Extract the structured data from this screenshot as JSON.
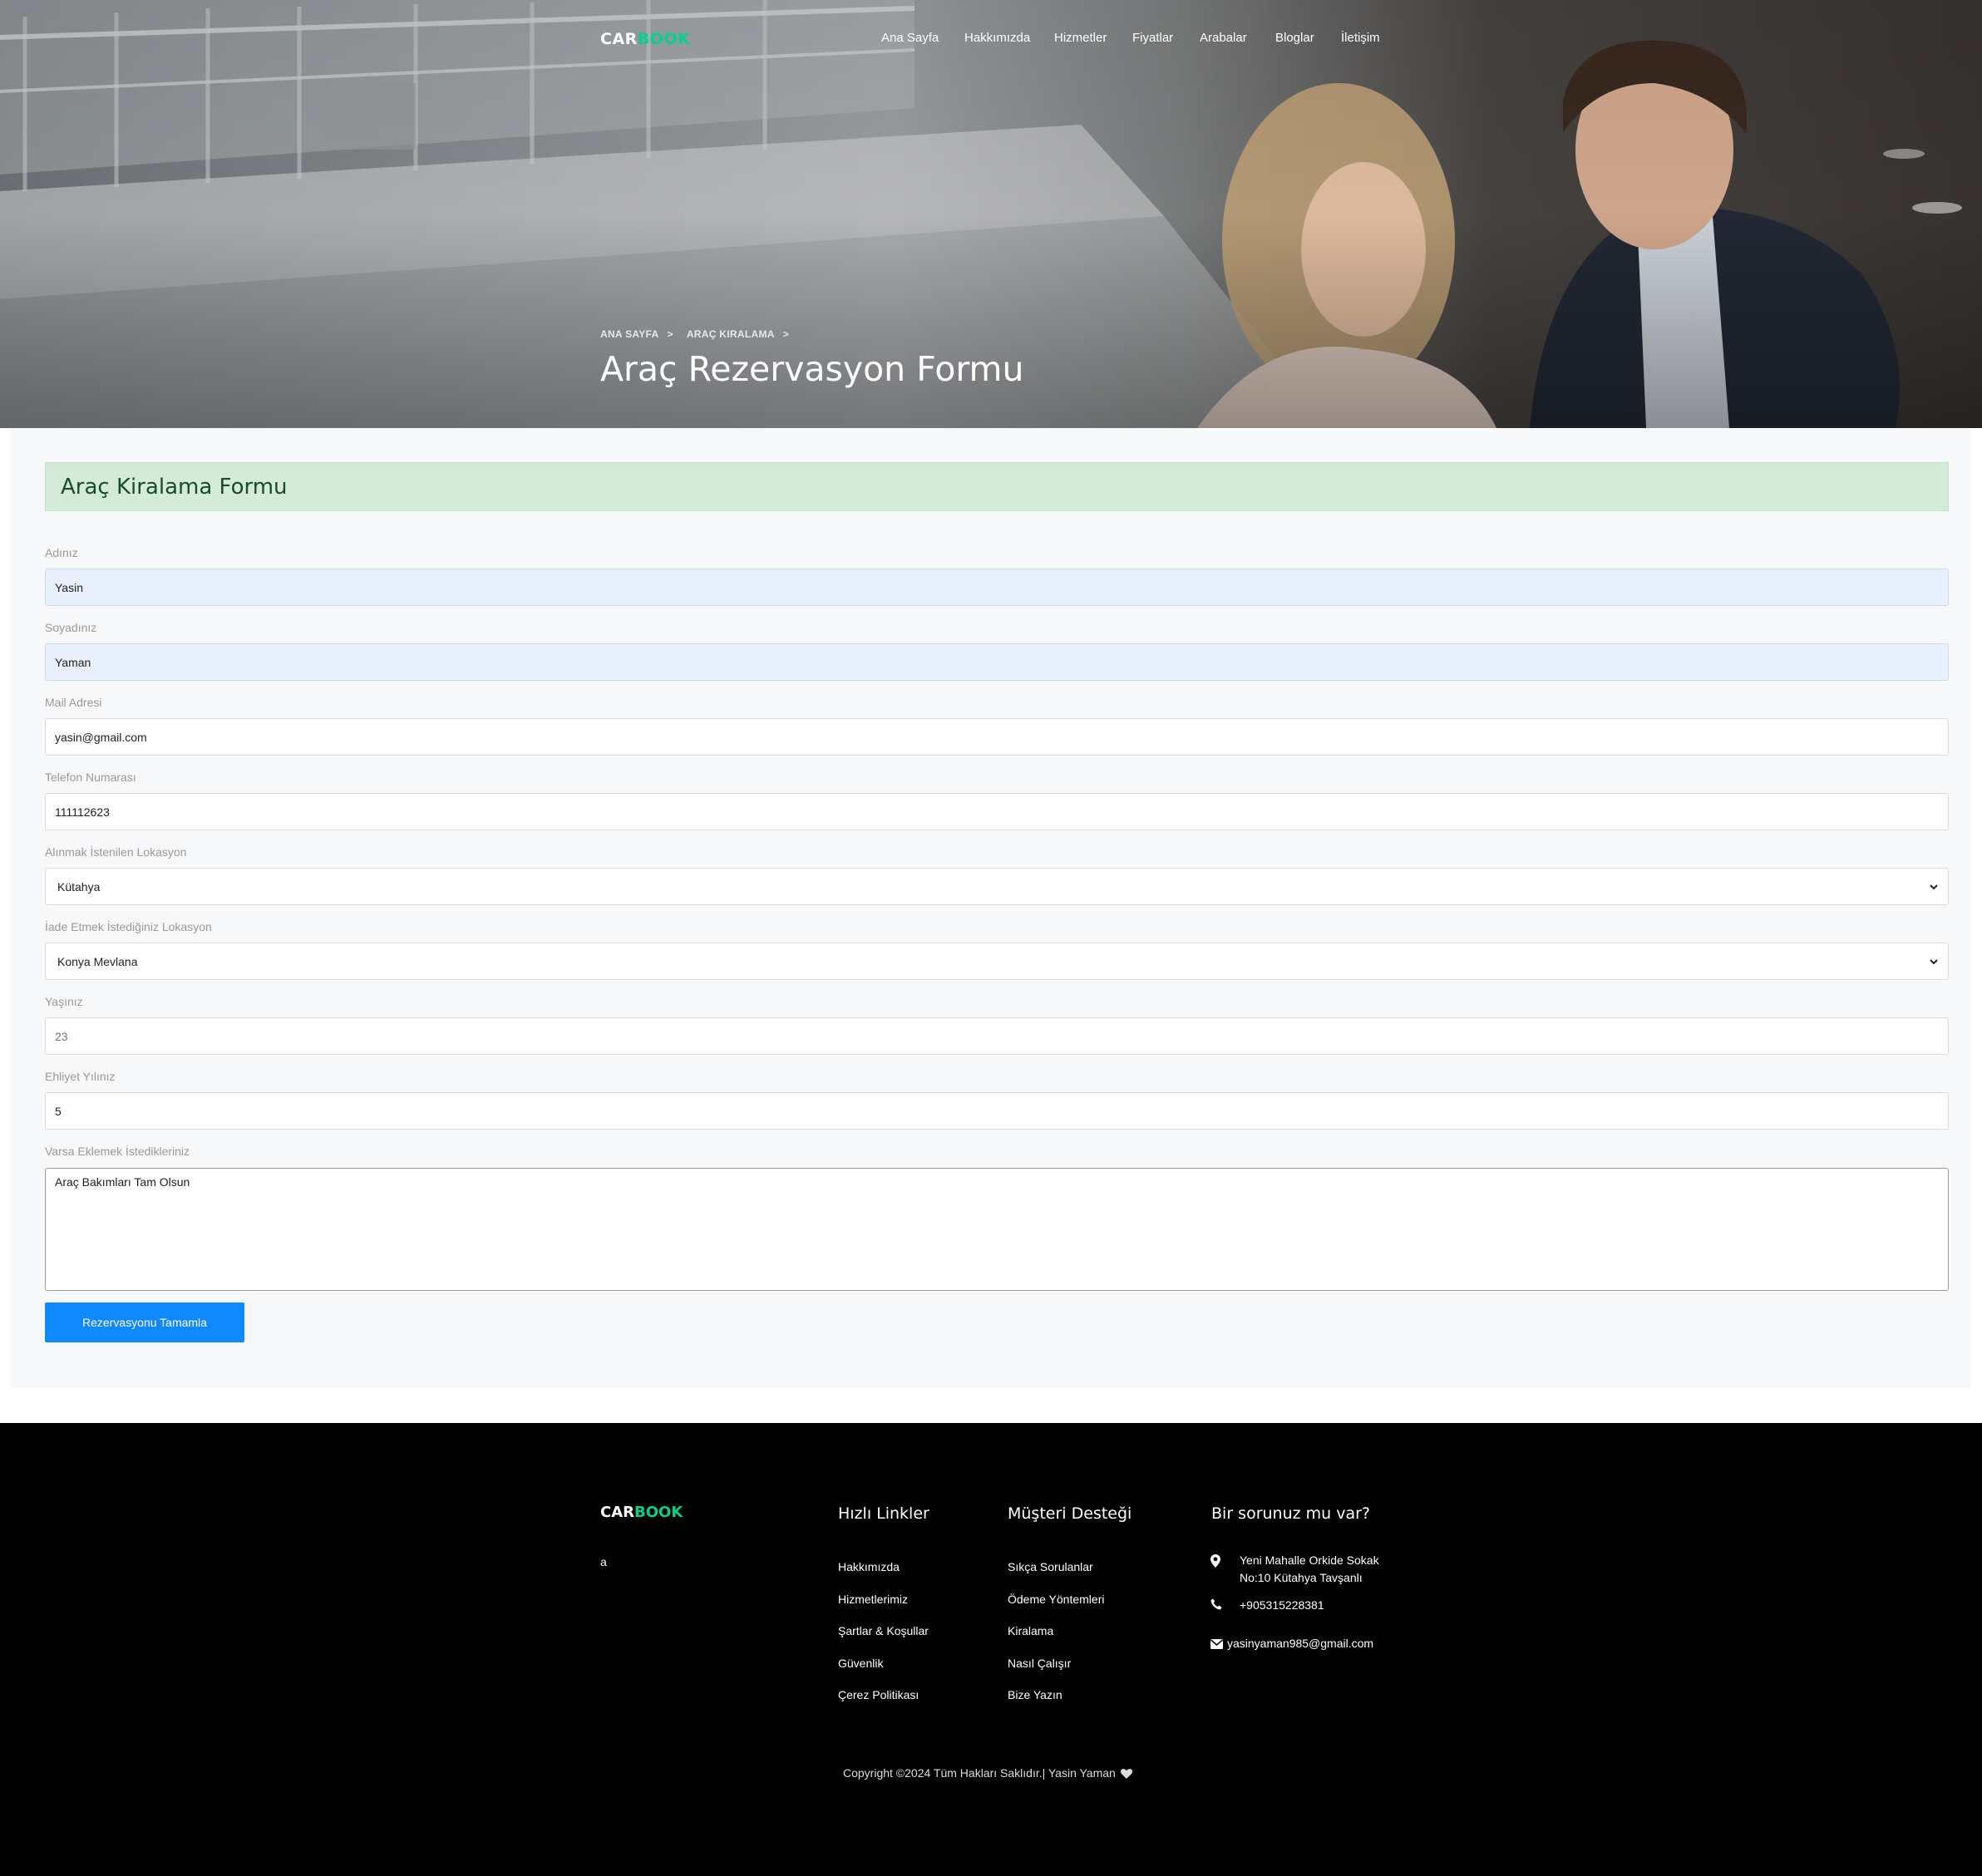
{
  "brand": {
    "part1": "CAR",
    "part2": "BOOK"
  },
  "nav": {
    "items": [
      {
        "label": "Ana Sayfa"
      },
      {
        "label": "Hakkımızda"
      },
      {
        "label": "Hizmetler"
      },
      {
        "label": "Fiyatlar"
      },
      {
        "label": "Arabalar"
      },
      {
        "label": "Bloglar"
      },
      {
        "label": "İletişim"
      }
    ]
  },
  "hero": {
    "breadcrumb": [
      "ANA SAYFA",
      "ARAÇ KIRALAMA"
    ],
    "breadcrumb_sep": ">",
    "title": "Araç Rezervasyon Formu"
  },
  "form": {
    "alert_title": "Araç Kiralama Formu",
    "fields": [
      {
        "label": "Adınız",
        "value": "Yasin"
      },
      {
        "label": "Soyadınız",
        "value": "Yaman"
      },
      {
        "label": "Mail Adresi",
        "value": "yasin@gmail.com"
      },
      {
        "label": "Telefon Numarası",
        "value": "111112623"
      },
      {
        "label": "Alınmak İstenilen Lokasyon",
        "value": "Kütahya"
      },
      {
        "label": "İade Etmek İstediğiniz Lokasyon",
        "value": "Konya Mevlana"
      },
      {
        "label": "Yaşınız",
        "placeholder": "23"
      },
      {
        "label": "Ehliyet Yılınız",
        "value": "5"
      },
      {
        "label": "Varsa Eklemek İstedikleriniz",
        "value": "Araç Bakımları Tam Olsun"
      }
    ],
    "submit_label": "Rezervasyonu Tamamla"
  },
  "footer": {
    "brand": {
      "part1": "CAR",
      "part2": "BOOK"
    },
    "about": "a",
    "quick_links": {
      "title": "Hızlı Linkler",
      "items": [
        "Hakkımızda",
        "Hizmetlerimiz",
        "Şartlar & Koşullar",
        "Güvenlik",
        "Çerez Politikası"
      ]
    },
    "support": {
      "title": "Müşteri Desteği",
      "items": [
        "Sıkça Sorulanlar",
        "Ödeme Yöntemleri",
        "Kiralama",
        "Nasıl Çalışır",
        "Bize Yazın"
      ]
    },
    "contact": {
      "title": "Bir sorunuz mu var?",
      "address_line1": "Yeni Mahalle Orkide Sokak",
      "address_line2": "No:10 Kütahya Tavşanlı",
      "phone": "+905315228381",
      "email": "yasinyaman985@gmail.com"
    },
    "copyright": "Copyright ©2024 Tüm Hakları Saklıdır.| Yasin Yaman"
  },
  "colors": {
    "brand_green": "#01d28e",
    "primary_blue": "#1089ff",
    "alert_bg": "#d4ebda"
  },
  "icons": [
    "map-marker-icon",
    "phone-icon",
    "envelope-icon",
    "heart-icon",
    "chevron-down-icon"
  ]
}
